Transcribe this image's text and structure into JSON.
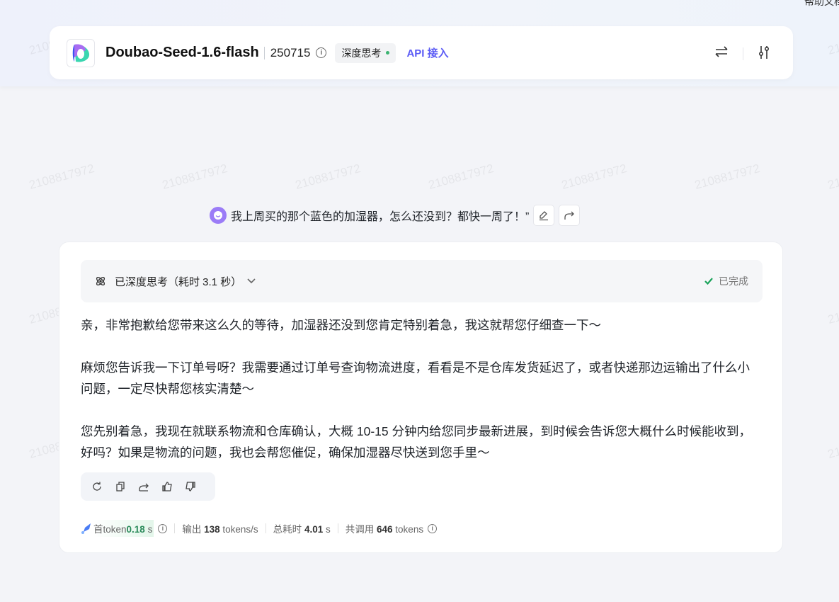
{
  "watermark": "2108817972",
  "top_link": "帮助文档",
  "header": {
    "title": "Doubao-Seed-1.6-flash",
    "version": "250715",
    "info_icon": "info-icon",
    "badge": "深度思考",
    "badge_dot_color": "#3cb371",
    "api_link": "API 接入",
    "icons": [
      "swap-icon",
      "settings-sliders-icon"
    ]
  },
  "user_message": {
    "text": "我上周买的那个蓝色的加湿器，怎么还没到？都快一周了！”",
    "actions": [
      "edit-icon",
      "share-icon"
    ]
  },
  "response": {
    "thinking_label": "已深度思考（耗时 3.1 秒）",
    "status": "已完成",
    "paragraphs": [
      "亲，非常抱歉给您带来这么久的等待，加湿器还没到您肯定特别着急，我这就帮您仔细查一下～",
      "麻烦您告诉我一下订单号呀？我需要通过订单号查询物流进度，看看是不是仓库发货延迟了，或者快递那边运输出了什么小问题，一定尽快帮您核实清楚～",
      "您先别着急，我现在就联系物流和仓库确认，大概 10-15 分钟内给您同步最新进展，到时候会告诉您大概什么时候能收到，好吗？如果是物流的问题，我也会帮您催促，确保加湿器尽快送到您手里～"
    ],
    "actions": [
      "regenerate-icon",
      "copy-icon",
      "share-icon",
      "thumbs-up-icon",
      "thumbs-down-icon"
    ]
  },
  "stats": {
    "first_token_label": "首token",
    "first_token_value": "0.18",
    "first_token_unit": "s",
    "output_label": "输出",
    "output_value": "138",
    "output_unit": "tokens/s",
    "total_label": "总耗时",
    "total_value": "4.01",
    "total_unit": "s",
    "usage_label": "共调用",
    "usage_value": "646",
    "usage_unit": "tokens"
  },
  "colors": {
    "accent": "#5b5bf5",
    "success": "#1aa35a"
  }
}
